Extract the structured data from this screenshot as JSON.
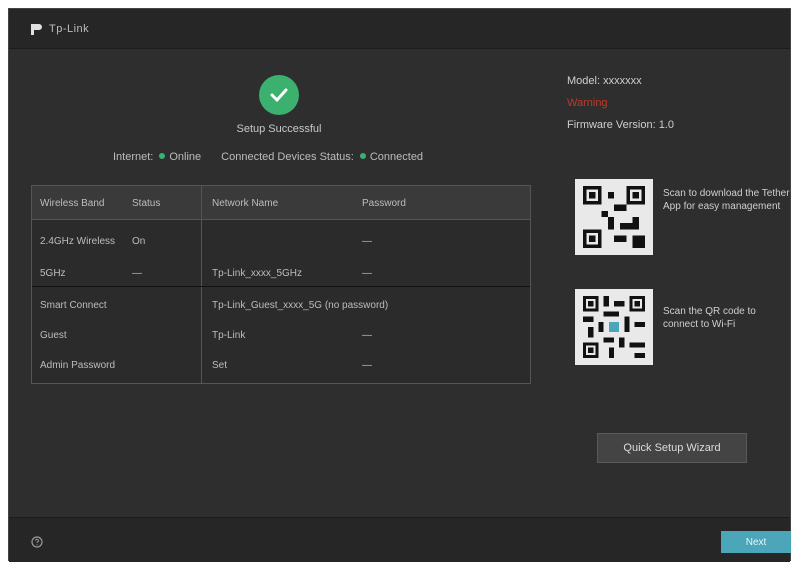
{
  "app": {
    "brand": "Tp-Link",
    "accent_color": "#4aa6b8",
    "ok_color": "#3cb06f",
    "warn_color": "#c0392b"
  },
  "status": {
    "icon": "check-circle-icon",
    "title": "Setup Successful",
    "internet_label": "Internet:",
    "internet_value": "Online",
    "device_label": "Connected Devices Status:",
    "device_value": "Connected"
  },
  "table": {
    "headers": [
      "Wireless Band",
      "Status",
      "Network Name",
      "Password"
    ],
    "rows": [
      [
        "2.4GHz Wireless",
        "On",
        "",
        "—"
      ],
      [
        "5GHz",
        "—",
        "Tp-Link_xxxx_5GHz",
        "—"
      ],
      [
        "Smart Connect",
        "",
        "Tp-Link_Guest_xxxx_5G (no password)",
        ""
      ],
      [
        "Guest",
        "",
        "Tp-Link",
        "—"
      ],
      [
        "Admin Password",
        "",
        "Set",
        "—"
      ]
    ]
  },
  "right": {
    "line1": "Model: xxxxxxx",
    "line2": "Warning",
    "line3": "Firmware Version: 1.0"
  },
  "qr1": {
    "icon": "qr-code-icon",
    "text": "Scan to download the Tether App for easy management"
  },
  "qr2": {
    "icon": "qr-code-icon",
    "text": "Scan the QR code to connect to Wi-Fi"
  },
  "buttons": {
    "wizard": "Quick Setup Wizard",
    "next": "Next"
  }
}
